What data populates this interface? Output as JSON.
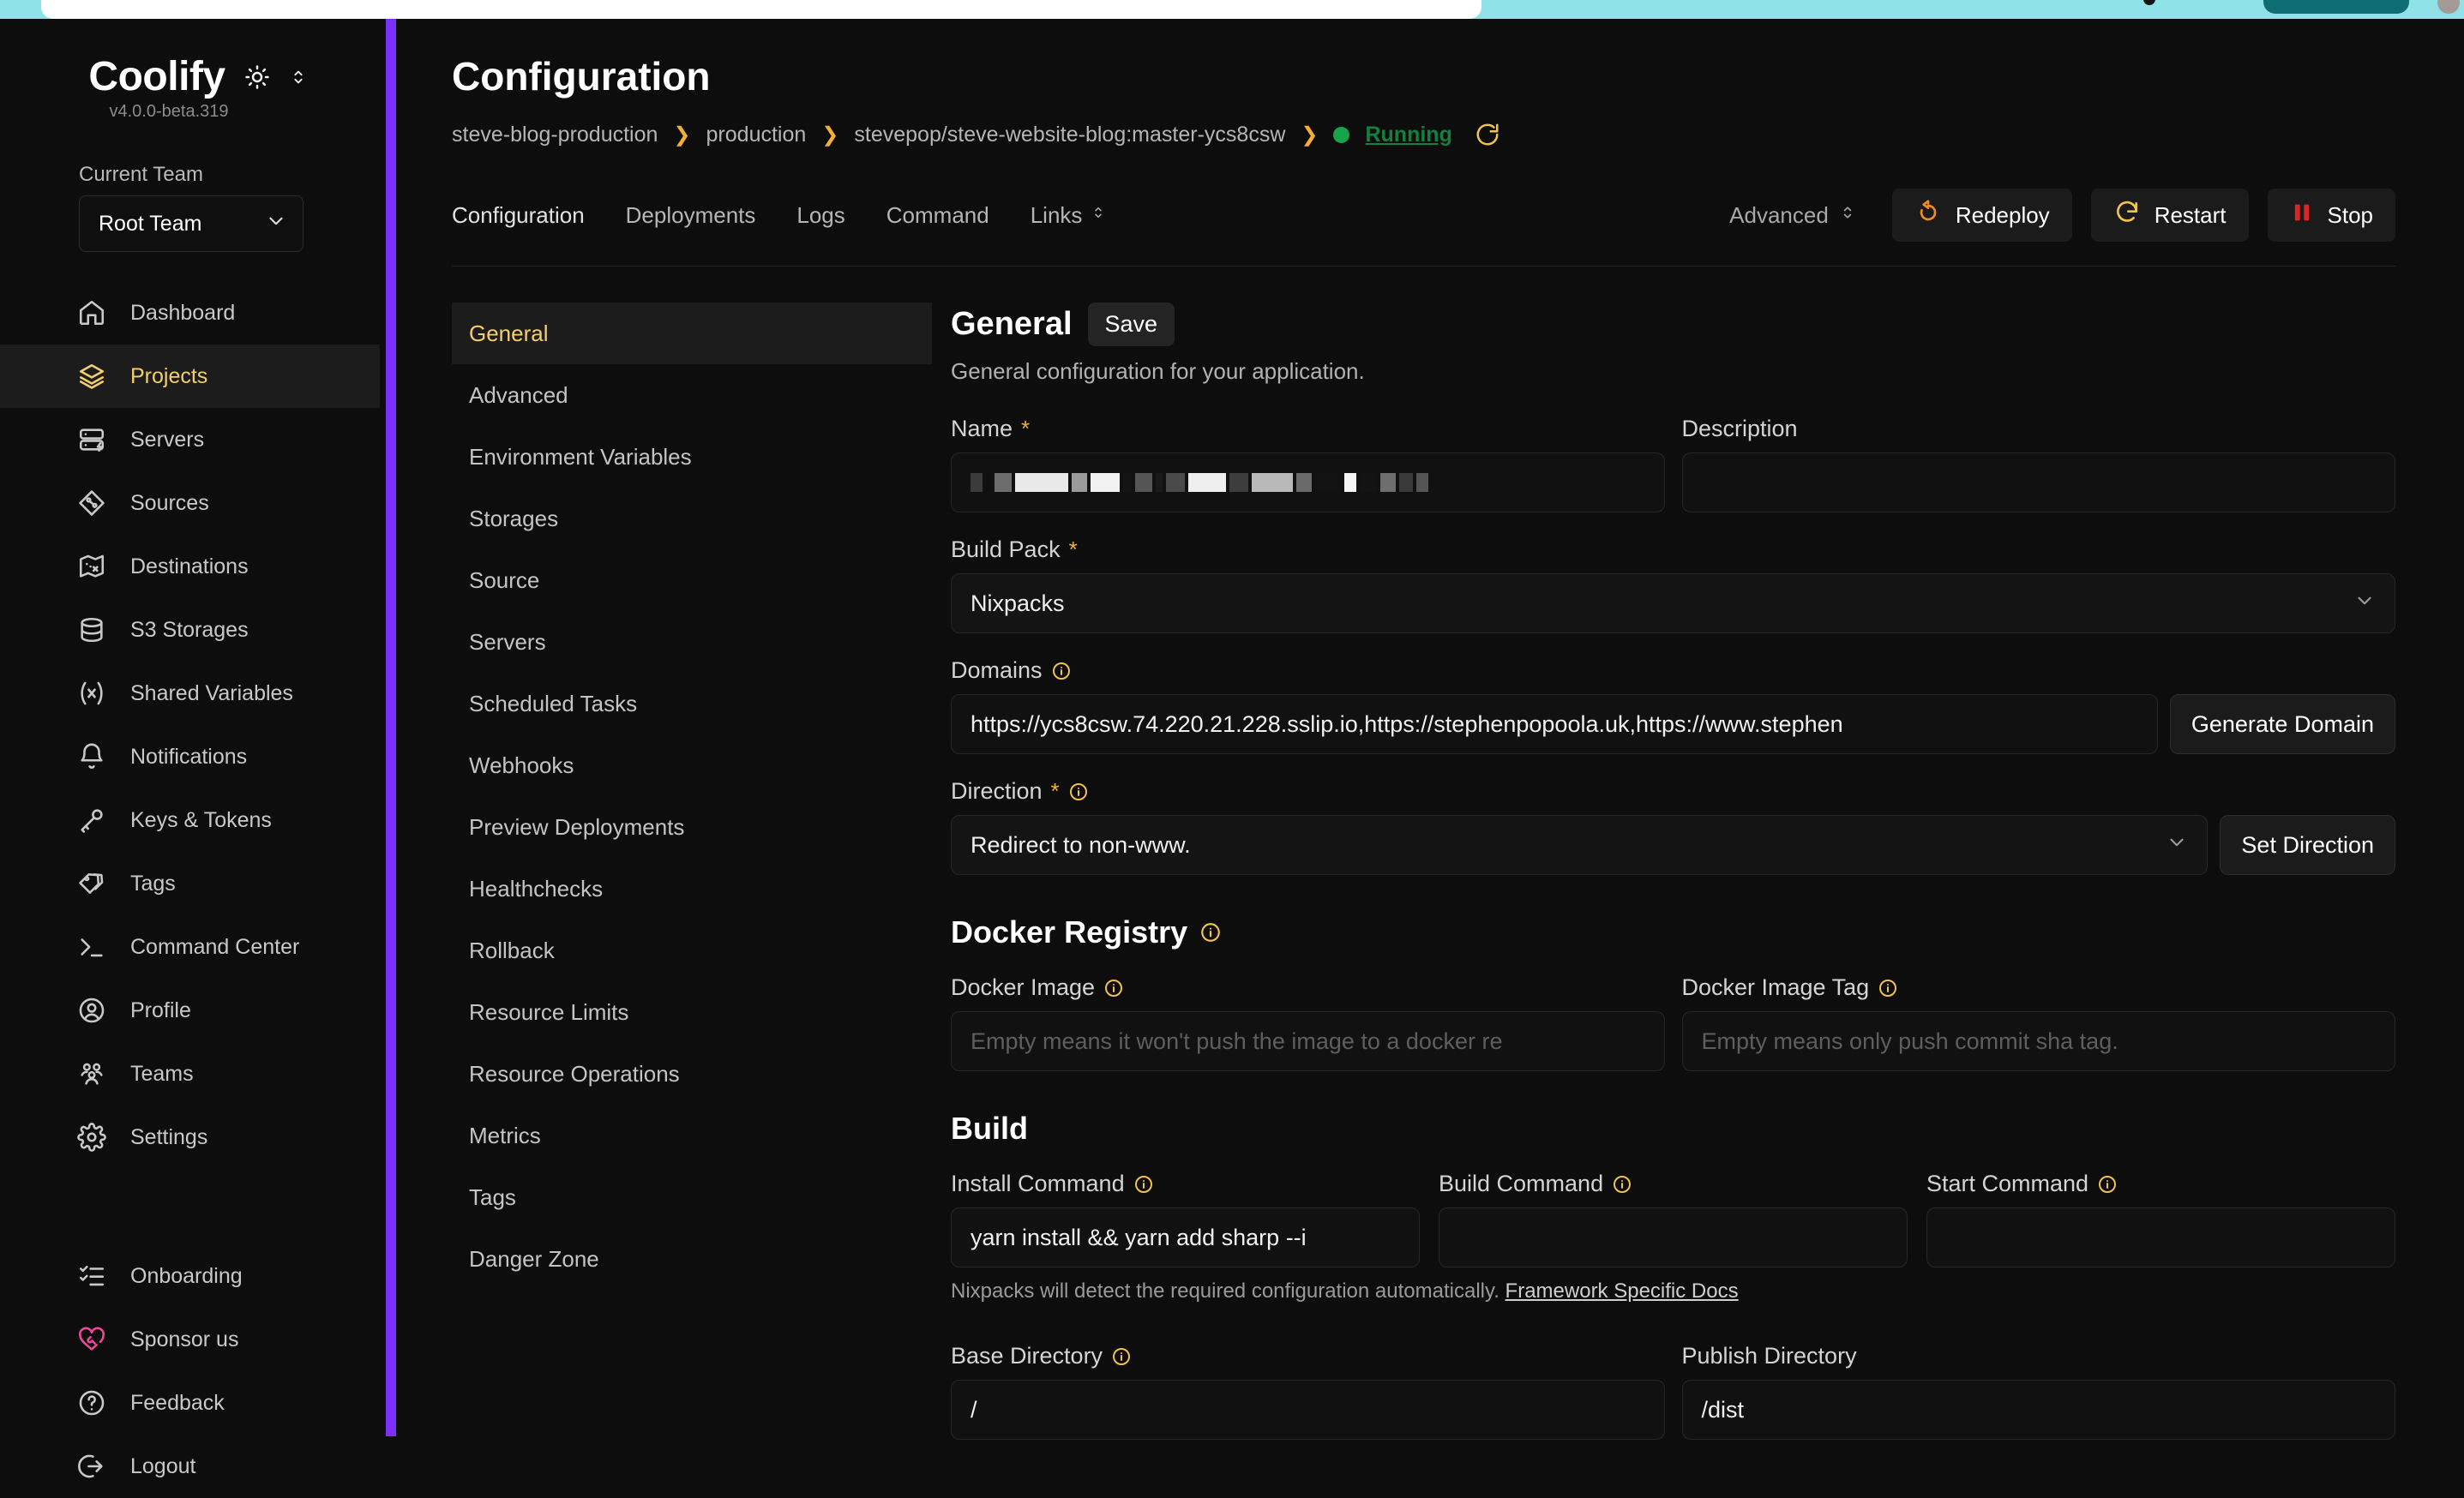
{
  "browser": {
    "present": true
  },
  "sidebar": {
    "brand": "Coolify",
    "version": "v4.0.0-beta.319",
    "theme_toggle_icon": "sun-icon",
    "theme_chevron_icon": "chevron-updown-icon",
    "current_team_label": "Current Team",
    "current_team_value": "Root Team",
    "items": [
      {
        "label": "Dashboard",
        "icon": "home-icon",
        "active": false
      },
      {
        "label": "Projects",
        "icon": "layers-icon",
        "active": true
      },
      {
        "label": "Servers",
        "icon": "server-icon",
        "active": false
      },
      {
        "label": "Sources",
        "icon": "git-diamond-icon",
        "active": false
      },
      {
        "label": "Destinations",
        "icon": "map-icon",
        "active": false
      },
      {
        "label": "S3 Storages",
        "icon": "database-icon",
        "active": false
      },
      {
        "label": "Shared Variables",
        "icon": "variable-icon",
        "active": false
      },
      {
        "label": "Notifications",
        "icon": "bell-icon",
        "active": false
      },
      {
        "label": "Keys & Tokens",
        "icon": "key-icon",
        "active": false
      },
      {
        "label": "Tags",
        "icon": "tags-icon",
        "active": false
      },
      {
        "label": "Command Center",
        "icon": "terminal-icon",
        "active": false
      },
      {
        "label": "Profile",
        "icon": "user-circle-icon",
        "active": false
      },
      {
        "label": "Teams",
        "icon": "users-icon",
        "active": false
      },
      {
        "label": "Settings",
        "icon": "gear-icon",
        "active": false
      }
    ],
    "items_secondary": [
      {
        "label": "Onboarding",
        "icon": "checklist-icon"
      },
      {
        "label": "Sponsor us",
        "icon": "heart-handshake-icon"
      },
      {
        "label": "Feedback",
        "icon": "question-circle-icon"
      },
      {
        "label": "Logout",
        "icon": "logout-icon"
      }
    ]
  },
  "header": {
    "title": "Configuration",
    "breadcrumb": [
      "steve-blog-production",
      "production",
      "stevepop/steve-website-blog:master-ycs8csw"
    ],
    "status": "Running",
    "status_color": "#15803d",
    "refresh_icon": "refresh-icon"
  },
  "tabbar": {
    "tabs": [
      {
        "label": "Configuration",
        "active": true
      },
      {
        "label": "Deployments",
        "active": false
      },
      {
        "label": "Logs",
        "active": false
      },
      {
        "label": "Command",
        "active": false
      },
      {
        "label": "Links",
        "active": false,
        "chevron": true
      }
    ],
    "advanced_label": "Advanced",
    "buttons": [
      {
        "label": "Redeploy",
        "icon": "redeploy-icon",
        "color": "#f08a24"
      },
      {
        "label": "Restart",
        "icon": "restart-icon",
        "color": "#f2c14e"
      },
      {
        "label": "Stop",
        "icon": "pause-icon",
        "color": "#e02424"
      }
    ]
  },
  "submenu": {
    "items": [
      {
        "label": "General",
        "active": true
      },
      {
        "label": "Advanced",
        "active": false
      },
      {
        "label": "Environment Variables",
        "active": false
      },
      {
        "label": "Storages",
        "active": false
      },
      {
        "label": "Source",
        "active": false
      },
      {
        "label": "Servers",
        "active": false
      },
      {
        "label": "Scheduled Tasks",
        "active": false
      },
      {
        "label": "Webhooks",
        "active": false
      },
      {
        "label": "Preview Deployments",
        "active": false
      },
      {
        "label": "Healthchecks",
        "active": false
      },
      {
        "label": "Rollback",
        "active": false
      },
      {
        "label": "Resource Limits",
        "active": false
      },
      {
        "label": "Resource Operations",
        "active": false
      },
      {
        "label": "Metrics",
        "active": false
      },
      {
        "label": "Tags",
        "active": false
      },
      {
        "label": "Danger Zone",
        "active": false
      }
    ]
  },
  "general": {
    "title": "General",
    "save_label": "Save",
    "description": "General configuration for your application.",
    "name_label": "Name",
    "name_value": "",
    "name_redacted": true,
    "description_label": "Description",
    "description_value": "",
    "buildpack_label": "Build Pack",
    "buildpack_value": "Nixpacks",
    "domains_label": "Domains",
    "domains_value": "https://ycs8csw.74.220.21.228.sslip.io,https://stephenpopoola.uk,https://www.stephen",
    "generate_domain_label": "Generate Domain",
    "direction_label": "Direction",
    "direction_value": "Redirect to non-www.",
    "set_direction_label": "Set Direction"
  },
  "docker_registry": {
    "title": "Docker Registry",
    "image_label": "Docker Image",
    "image_placeholder": "Empty means it won't push the image to a docker re",
    "image_value": "",
    "tag_label": "Docker Image Tag",
    "tag_placeholder": "Empty means only push commit sha tag.",
    "tag_value": ""
  },
  "build": {
    "title": "Build",
    "install_label": "Install Command",
    "install_value": "yarn install && yarn add sharp --i",
    "build_label": "Build Command",
    "build_value": "",
    "start_label": "Start Command",
    "start_value": "",
    "hint_text": "Nixpacks will detect the required configuration automatically.",
    "hint_link": "Framework Specific Docs",
    "base_dir_label": "Base Directory",
    "base_dir_value": "/",
    "publish_dir_label": "Publish Directory",
    "publish_dir_value": "/dist"
  },
  "colors": {
    "accent_yellow": "#f2cf6b",
    "scrollbar_purple": "#7c2ffc",
    "status_green": "#15803d",
    "sponsor_pink": "#ec4899"
  }
}
